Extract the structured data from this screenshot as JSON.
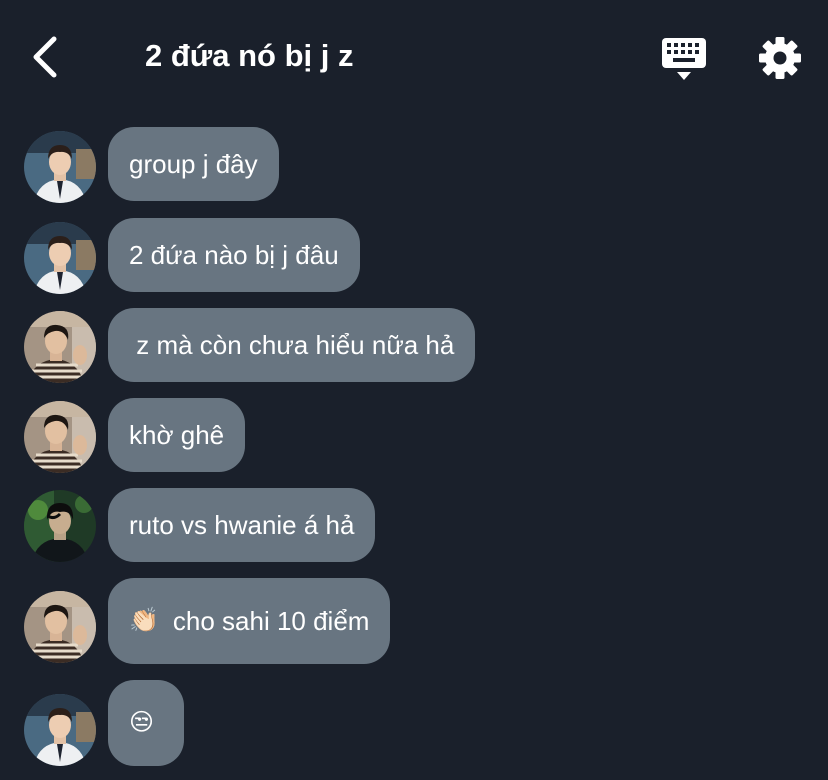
{
  "header": {
    "title": "2 đứa nó bị j z",
    "back_icon": "chevron-left-icon",
    "keyboard_icon": "keyboard-icon",
    "settings_icon": "gear-icon"
  },
  "messages": [
    {
      "text": "group j đây",
      "avatar": "avatar-boy-uniform"
    },
    {
      "text": "2 đứa nào bị j đâu",
      "avatar": "avatar-boy-uniform"
    },
    {
      "text": " z mà còn chưa hiểu nữa hả",
      "avatar": "avatar-boy-stripes"
    },
    {
      "text": "khờ ghê",
      "avatar": "avatar-boy-stripes"
    },
    {
      "text": "ruto vs hwanie á hả",
      "avatar": "avatar-boy-green"
    },
    {
      "emoji": "👏🏻",
      "text": "cho sahi 10 điểm",
      "avatar": "avatar-boy-stripes"
    },
    {
      "emoji": "😒",
      "text": "",
      "avatar": "avatar-boy-uniform"
    }
  ],
  "colors": {
    "background": "#1a202b",
    "bubble": "#687581",
    "text": "#ffffff"
  }
}
